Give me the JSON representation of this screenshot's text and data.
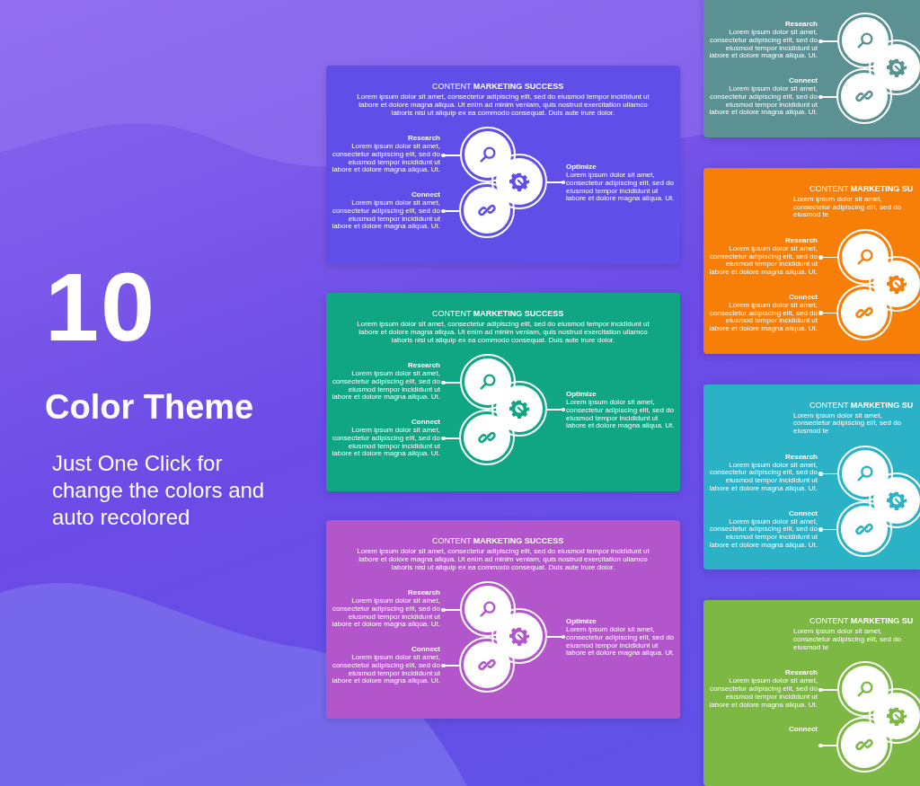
{
  "promo": {
    "number": "10",
    "heading": "Color Theme",
    "subheading": "Just One Click for change the colors and auto recolored"
  },
  "columns": [
    {
      "slides": [
        {
          "color": "#5f4ee8",
          "title": "CONTENT **MARKETING SUCCESS**",
          "description": "Lorem ipsum dolor sit amet, consectetur adipiscing elit, sed do eiusmod tempor incididunt ut labore et dolore magna aliqua. Ut enim ad minim veniam, quis nostrud exercitation ullamco laboris nisi ut aliquip ex ea commodo consequat. Duis aute irure dolor.",
          "items": [
            {
              "kind": "search",
              "label": "Research",
              "text": "Lorem ipsum dolor sit amet, consectetur adipiscing elit, sed do eiusmod tempor incididunt ut labore et dolore magna aliqua. Ut."
            },
            {
              "kind": "gear",
              "label": "Optimize",
              "text": "Lorem ipsum dolor sit amet, consectetur adipiscing elit, sed do eiusmod tempor incididunt ut labore et dolore magna aliqua. Ut."
            },
            {
              "kind": "link",
              "label": "Connect",
              "text": "Lorem ipsum dolor sit amet, consectetur adipiscing elit, sed do eiusmod tempor incididunt ut labore et dolore magna aliqua. Ut."
            }
          ]
        },
        {
          "color": "#10a583",
          "title": "CONTENT **MARKETING SUCCESS**",
          "description": "Lorem ipsum dolor sit amet, consectetur adipiscing elit, sed do eiusmod tempor incididunt ut labore et dolore magna aliqua. Ut enim ad minim veniam, quis nostrud exercitation ullamco laboris nisi ut aliquip ex ea commodo consequat. Duis aute irure dolor.",
          "items": [
            {
              "kind": "search",
              "label": "Research",
              "text": "Lorem ipsum dolor sit amet, consectetur adipiscing elit, sed do eiusmod tempor incididunt ut labore et dolore magna aliqua. Ut."
            },
            {
              "kind": "gear",
              "label": "Optimize",
              "text": "Lorem ipsum dolor sit amet, consectetur adipiscing elit, sed do eiusmod tempor incididunt ut labore et dolore magna aliqua. Ut."
            },
            {
              "kind": "link",
              "label": "Connect",
              "text": "Lorem ipsum dolor sit amet, consectetur adipiscing elit, sed do eiusmod tempor incididunt ut labore et dolore magna aliqua. Ut."
            }
          ]
        },
        {
          "color": "#b456cb",
          "title": "CONTENT **MARKETING SUCCESS**",
          "description": "Lorem ipsum dolor sit amet, consectetur adipiscing elit, sed do eiusmod tempor incididunt ut labore et dolore magna aliqua. Ut enim ad minim veniam, quis nostrud exercitation ullamco laboris nisi ut aliquip ex ea commodo consequat. Duis aute irure dolor.",
          "items": [
            {
              "kind": "search",
              "label": "Research",
              "text": "Lorem ipsum dolor sit amet, consectetur adipiscing elit, sed do eiusmod tempor incididunt ut labore et dolore magna aliqua. Ut."
            },
            {
              "kind": "gear",
              "label": "Optimize",
              "text": "Lorem ipsum dolor sit amet, consectetur adipiscing elit, sed do eiusmod tempor incididunt ut labore et dolore magna aliqua. Ut."
            },
            {
              "kind": "link",
              "label": "Connect",
              "text": "Lorem ipsum dolor sit amet, consectetur adipiscing elit, sed do eiusmod tempor incididunt ut labore et dolore magna aliqua. Ut."
            }
          ]
        }
      ]
    },
    {
      "slides": [
        {
          "color": "#5b9193",
          "items": [
            {
              "kind": "search",
              "label": "Research",
              "text": "Lorem ipsum dolor sit amet, consectetur adipiscing elit, sed do eiusmod tempor incididunt ut labore et dolore magna aliqua. Ut."
            },
            {
              "kind": "gear"
            },
            {
              "kind": "link",
              "label": "Connect",
              "text": "Lorem ipsum dolor sit amet, consectetur adipiscing elit, sed do eiusmod tempor incididunt ut labore et dolore magna aliqua. Ut."
            }
          ]
        },
        {
          "color": "#f77f08",
          "title": "CONTENT **MARKETING SU**",
          "description": "Lorem ipsum dolor sit amet, consectetur adipiscing elit, sed do eiusmod te",
          "items": [
            {
              "kind": "search",
              "label": "Research",
              "text": "Lorem ipsum dolor sit amet, consectetur adipiscing elit, sed do eiusmod tempor incididunt ut labore et dolore magna aliqua. Ut."
            },
            {
              "kind": "gear"
            },
            {
              "kind": "link",
              "label": "Connect",
              "text": "Lorem ipsum dolor sit amet, consectetur adipiscing elit, sed do eiusmod tempor incididunt ut labore et dolore magna aliqua. Ut."
            }
          ]
        },
        {
          "color": "#2cb2c6",
          "title": "CONTENT **MARKETING SU**",
          "description": "Lorem ipsum dolor sit amet, consectetur adipiscing elit, sed do eiusmod te",
          "items": [
            {
              "kind": "search",
              "label": "Research",
              "text": "Lorem ipsum dolor sit amet, consectetur adipiscing elit, sed do eiusmod tempor incididunt ut labore et dolore magna aliqua. Ut."
            },
            {
              "kind": "gear"
            },
            {
              "kind": "link",
              "label": "Connect",
              "text": "Lorem ipsum dolor sit amet, consectetur adipiscing elit, sed do eiusmod tempor incididunt ut labore et dolore magna aliqua. Ut."
            }
          ]
        },
        {
          "color": "#7db845",
          "title": "CONTENT **MARKETING SU**",
          "description": "Lorem ipsum dolor sit amet, consectetur adipiscing elit, sed do eiusmod te",
          "items": [
            {
              "kind": "search",
              "label": "Research",
              "text": "Lorem ipsum dolor sit amet, consectetur adipiscing elit, sed do eiusmod tempor incididunt ut labore et dolore magna aliqua. Ut."
            },
            {
              "kind": "gear"
            },
            {
              "kind": "link",
              "label": "Connect"
            }
          ]
        }
      ]
    }
  ]
}
